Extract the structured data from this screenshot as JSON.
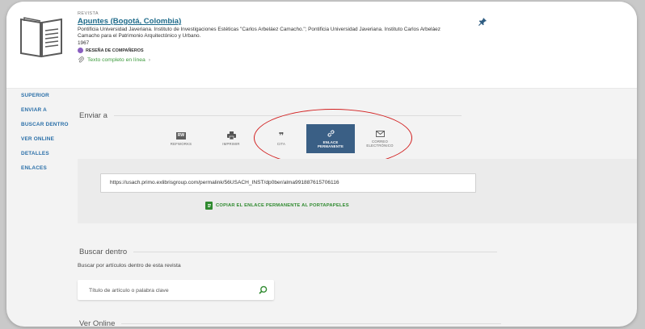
{
  "record": {
    "type": "REVISTA",
    "title": "Apuntes (Bogotá, Colombia)",
    "publisher": "Pontificia Universidad Javeriana. Instituto de Investigaciones Estéticas \"Carlos Arbeláez Camacho.\"; Pontificia Universidad Javeriana. Instituto Carlos Arbeláez Camacho para el Patrimonio Arquitectónico y Urbano.",
    "year": "1967",
    "peer_review": "RESEÑA DE COMPAÑEROS",
    "fulltext": "Texto completo en línea",
    "fulltext_arrow": "›"
  },
  "sidenav": {
    "items": [
      {
        "label": "SUPERIOR"
      },
      {
        "label": "ENVIAR A"
      },
      {
        "label": "BUSCAR DENTRO"
      },
      {
        "label": "VER ONLINE"
      },
      {
        "label": "DETALLES"
      },
      {
        "label": "ENLACES"
      }
    ]
  },
  "send_to": {
    "title": "Enviar a",
    "items": [
      {
        "label": "REFWORKS",
        "icon": "refworks-icon",
        "icon_text": "RW"
      },
      {
        "label": "IMPRIMIR",
        "icon": "printer-icon"
      },
      {
        "label": "CITA",
        "icon": "quote-icon",
        "icon_text": "❞"
      },
      {
        "label": "ENLACE PERMANENTE",
        "icon": "link-icon",
        "active": true
      },
      {
        "label": "CORREO ELECTRÓNICO",
        "icon": "mail-icon"
      }
    ],
    "permalink": "https://usach.primo.exlibrisgroup.com/permalink/56USACH_INST/dp0ber/alma991887615706116",
    "copy_label": "COPIAR EL ENLACE PERMANENTE AL PORTAPAPELES"
  },
  "search_within": {
    "title": "Buscar dentro",
    "description": "Buscar por artículos dentro de esta revista",
    "placeholder": "Título de artículo o palabra clave"
  },
  "view_online": {
    "title": "Ver Online"
  },
  "colors": {
    "accent_blue": "#3a5f85",
    "link_blue": "#2a6fa8",
    "green": "#2f8a2f",
    "annotation_red": "#d21f1f"
  }
}
